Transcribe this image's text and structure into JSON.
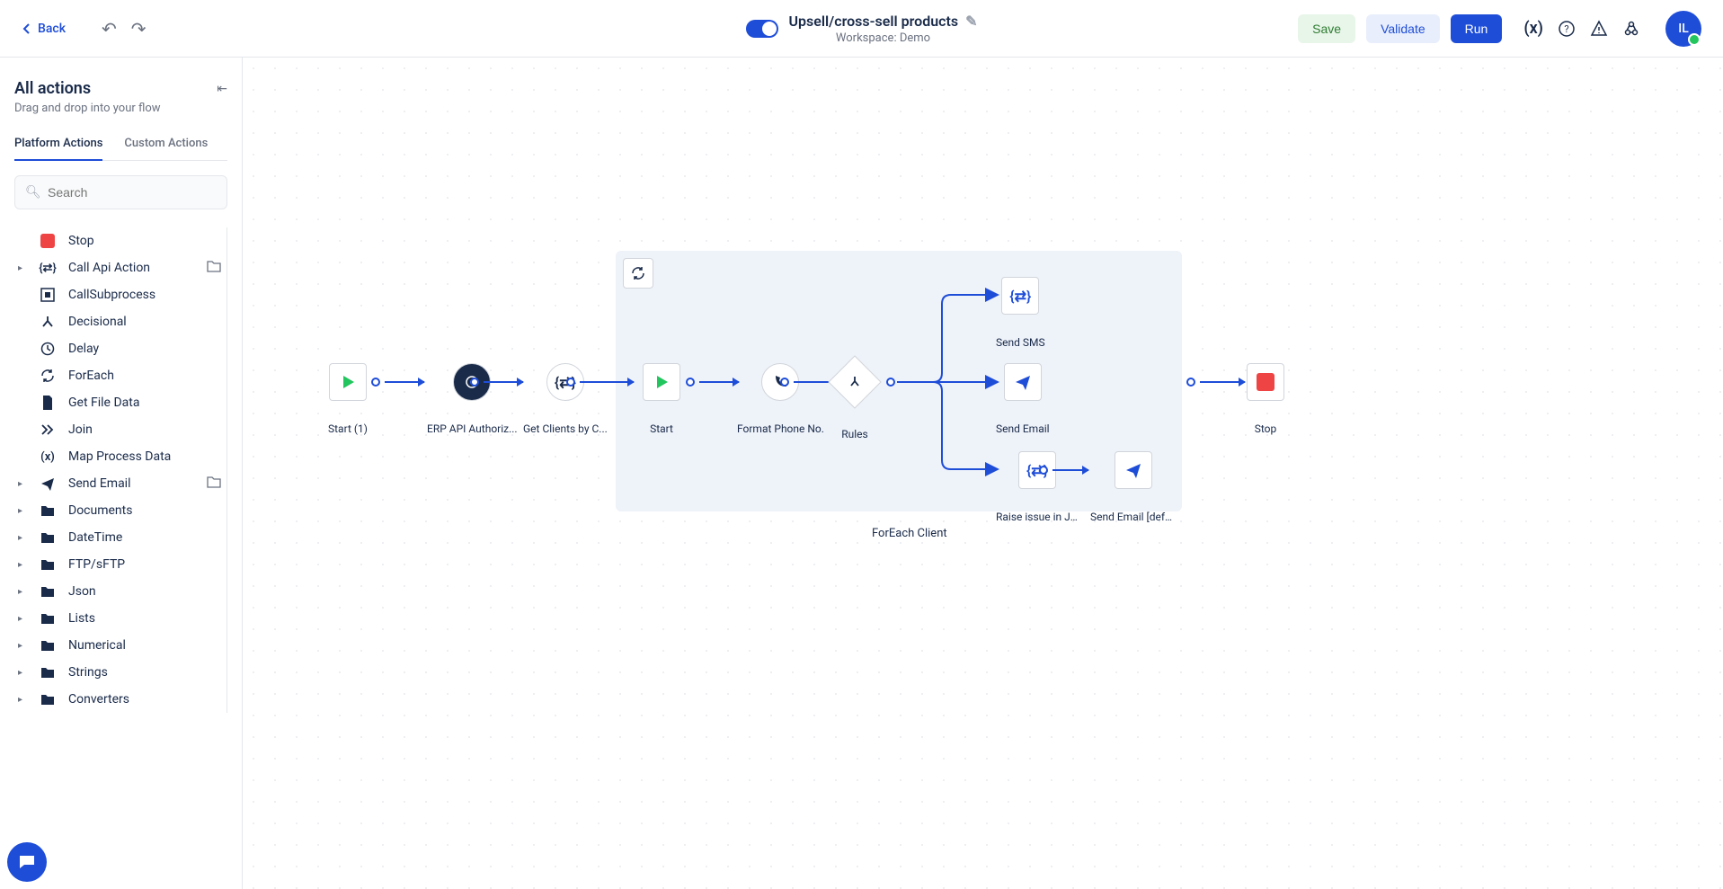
{
  "header": {
    "back": "Back",
    "title": "Upsell/cross-sell products",
    "workspace": "Workspace: Demo",
    "save": "Save",
    "validate": "Validate",
    "run": "Run",
    "avatar": "IL"
  },
  "sidebar": {
    "title": "All actions",
    "subtitle": "Drag and drop into your flow",
    "tabs": {
      "platform": "Platform Actions",
      "custom": "Custom Actions"
    },
    "search_placeholder": "Search",
    "items": [
      {
        "label": "Stop",
        "icon": "stop",
        "expandable": false,
        "folder": false
      },
      {
        "label": "Call Api Action",
        "icon": "api",
        "expandable": true,
        "folder": true
      },
      {
        "label": "CallSubprocess",
        "icon": "subprocess",
        "expandable": false,
        "folder": false
      },
      {
        "label": "Decisional",
        "icon": "fork",
        "expandable": false,
        "folder": false
      },
      {
        "label": "Delay",
        "icon": "clock",
        "expandable": false,
        "folder": false
      },
      {
        "label": "ForEach",
        "icon": "loop",
        "expandable": false,
        "folder": false
      },
      {
        "label": "Get File Data",
        "icon": "file",
        "expandable": false,
        "folder": false
      },
      {
        "label": "Join",
        "icon": "join",
        "expandable": false,
        "folder": false
      },
      {
        "label": "Map Process Data",
        "icon": "varx",
        "expandable": false,
        "folder": false
      },
      {
        "label": "Send Email",
        "icon": "send",
        "expandable": true,
        "folder": true
      },
      {
        "label": "Documents",
        "icon": "folder",
        "expandable": true,
        "folder": false
      },
      {
        "label": "DateTime",
        "icon": "folder",
        "expandable": true,
        "folder": false
      },
      {
        "label": "FTP/sFTP",
        "icon": "folder",
        "expandable": true,
        "folder": false
      },
      {
        "label": "Json",
        "icon": "folder",
        "expandable": true,
        "folder": false
      },
      {
        "label": "Lists",
        "icon": "folder",
        "expandable": true,
        "folder": false
      },
      {
        "label": "Numerical",
        "icon": "folder",
        "expandable": true,
        "folder": false
      },
      {
        "label": "Strings",
        "icon": "folder",
        "expandable": true,
        "folder": false
      },
      {
        "label": "Converters",
        "icon": "folder",
        "expandable": true,
        "folder": false
      }
    ]
  },
  "canvas": {
    "foreach_label": "ForEach Client",
    "nodes": {
      "start1": "Start (1)",
      "erp": "ERP API Authoriz...",
      "clients": "Get Clients by C...",
      "start2": "Start",
      "format": "Format Phone No.",
      "rules": "Rules",
      "sms": "Send SMS",
      "email": "Send Email",
      "jira": "Raise issue in J...",
      "email2": "Send Email [defa...",
      "stop": "Stop"
    }
  }
}
